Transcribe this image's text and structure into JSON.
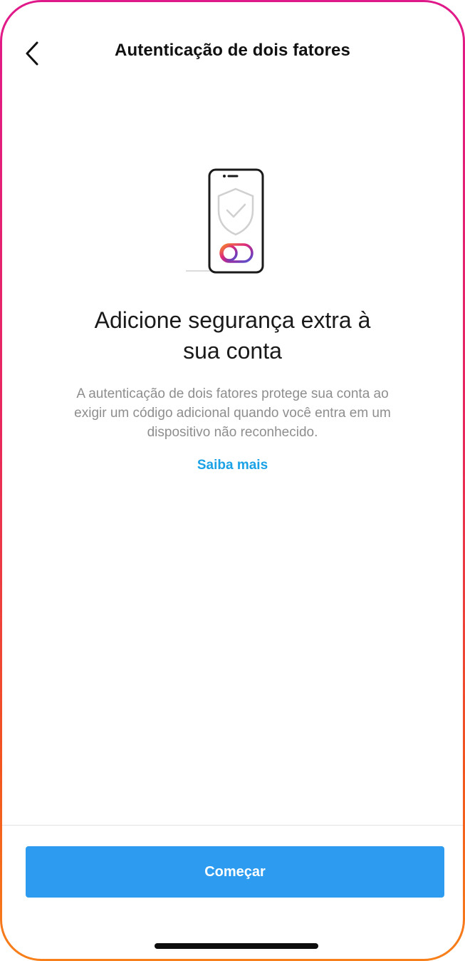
{
  "header": {
    "back_icon": "chevron-left-icon",
    "title": "Autenticação de dois fatores"
  },
  "illustration": {
    "icon": "phone-shield-icon",
    "accent_colors": [
      "#f58529",
      "#dd2a7b",
      "#8134af",
      "#515bd4"
    ]
  },
  "main": {
    "headline_line1": "Adicione segurança extra à",
    "headline_line2": "sua conta",
    "description_line1": "A autenticação de dois fatores protege sua conta ao",
    "description_line2": "exigir um código adicional quando você entra em um",
    "description_line3": "dispositivo não reconhecido.",
    "learn_more": "Saiba mais"
  },
  "footer": {
    "primary_button": "Começar"
  },
  "colors": {
    "primary": "#2d9bf0",
    "link": "#1aa1e6",
    "secondary_text": "#8e8e8e",
    "frame_gradient": [
      "#e0198a",
      "#f7801a"
    ]
  }
}
